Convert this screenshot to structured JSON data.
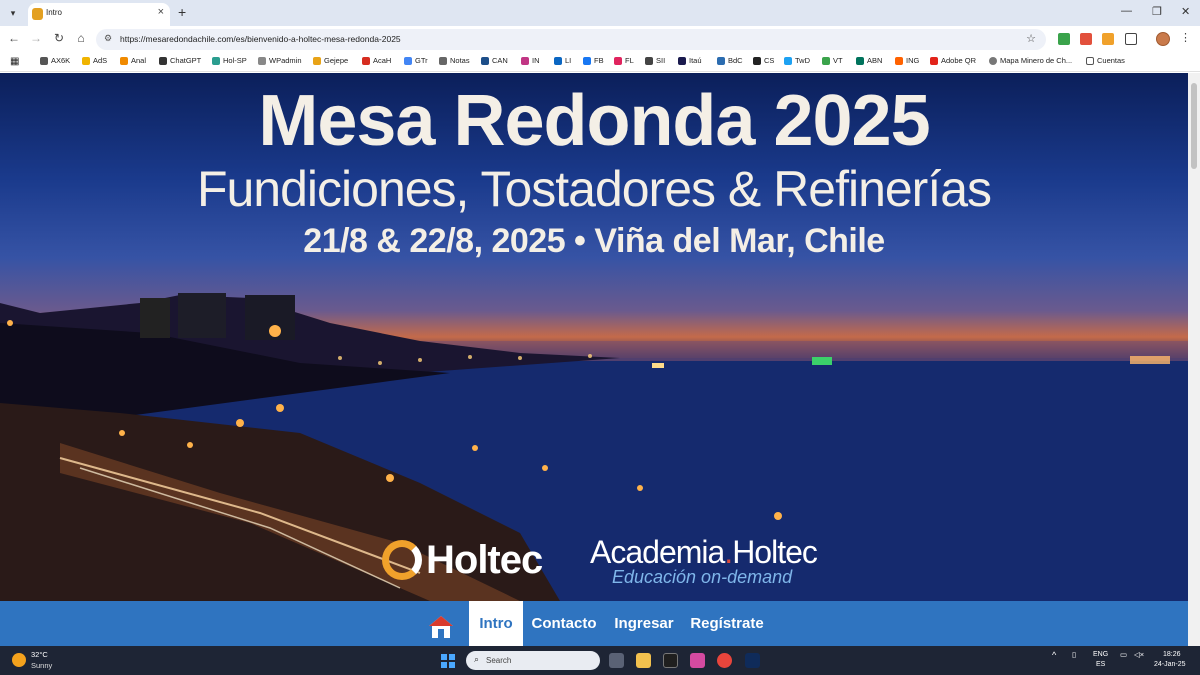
{
  "browser": {
    "tab_title": "Intro",
    "url": "https://mesaredondachile.com/es/bienvenido-a-holtec-mesa-redonda-2025",
    "bookmarks": [
      "AX6K",
      "AdS",
      "Anal",
      "ChatGPT",
      "Hol-SP",
      "WPadmin",
      "Gejepe",
      "AcaH",
      "GTr",
      "Notas",
      "CAN",
      "IN",
      "LI",
      "FB",
      "FL",
      "SII",
      "Itaú",
      "BdC",
      "CS",
      "TwD",
      "VT",
      "ABN",
      "ING",
      "Adobe QR",
      "Mapa Minero de Ch...",
      "Cuentas"
    ]
  },
  "hero": {
    "title": "Mesa Redonda 2025",
    "subtitle": "Fundiciones, Tostadores & Refinerías",
    "date_place": "21/8 & 22/8, 2025 • Viña del Mar, Chile",
    "holtec_logo": "Holtec",
    "academia_a": "Academia",
    "academia_b": "Holtec",
    "academia_tag": "Educación on-demand"
  },
  "nav": {
    "items": [
      "Intro",
      "Contacto",
      "Ingresar",
      "Regístrate"
    ],
    "active": "Intro"
  },
  "taskbar": {
    "weather_temp": "32°C",
    "weather_cond": "Sunny",
    "search_placeholder": "Search",
    "lang_1": "ENG",
    "lang_2": "ES",
    "time": "18:26",
    "date": "24-Jan-25"
  },
  "colors": {
    "nav_bar": "#2f74c0",
    "hero_text": "#f4efe6",
    "holtec_orange": "#f0a12b"
  }
}
